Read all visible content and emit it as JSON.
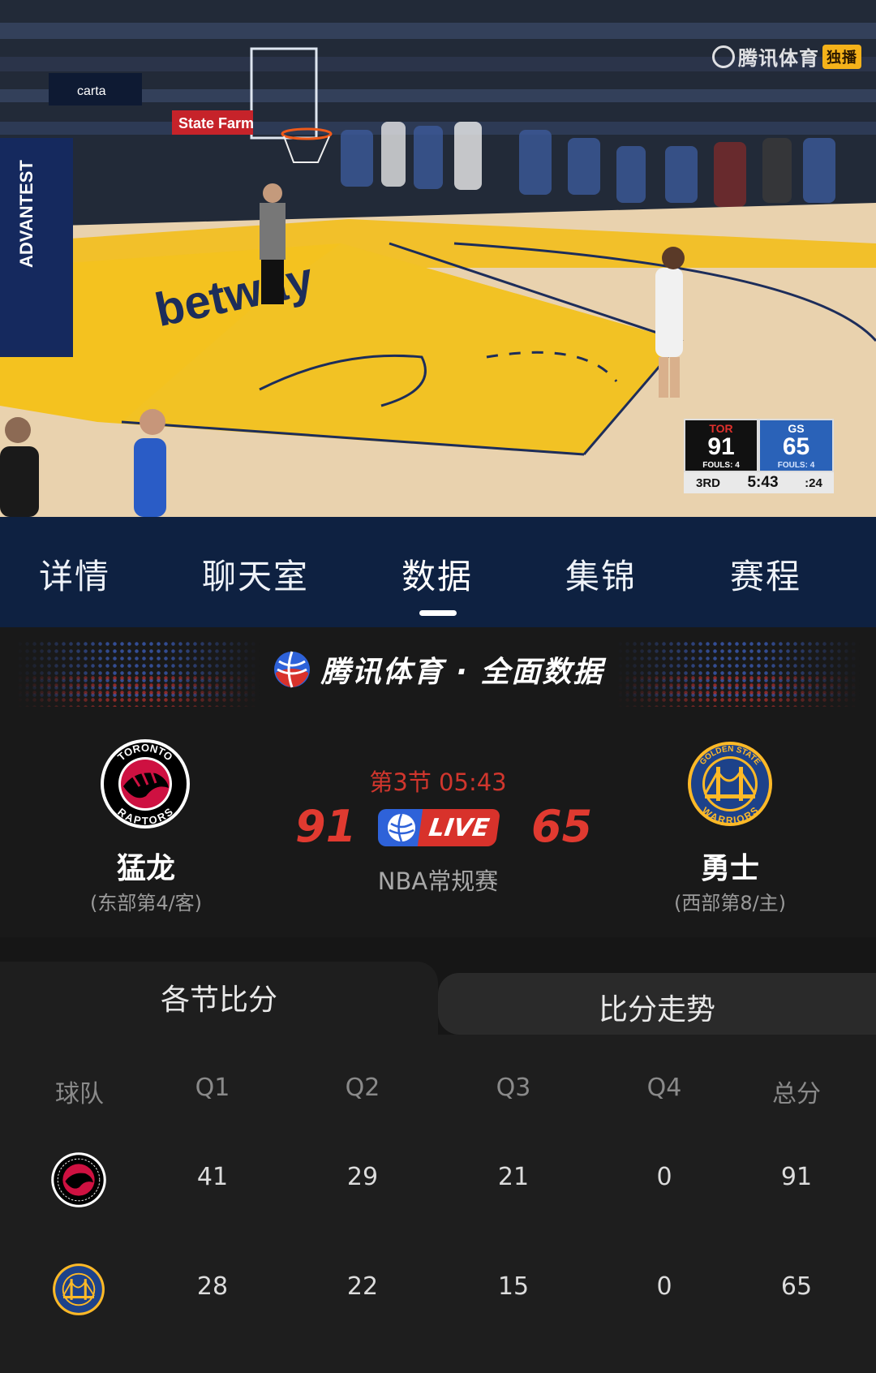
{
  "video": {
    "watermark": "腾讯体育",
    "watermark_tag": "独播",
    "arena_signs": [
      "State Farm",
      "carta",
      "ADVANTEST",
      "betway"
    ],
    "scorebug": {
      "away_abbr": "TOR",
      "home_abbr": "GS",
      "away_points": "91",
      "home_points": "65",
      "away_fouls": "FOULS: 4",
      "home_fouls": "FOULS: 4",
      "period": "3RD",
      "clock": "5:43",
      "shot_clock": ":24"
    }
  },
  "tabs": [
    {
      "label": "详情"
    },
    {
      "label": "聊天室"
    },
    {
      "label": "数据",
      "active": true
    },
    {
      "label": "集锦"
    },
    {
      "label": "赛程"
    }
  ],
  "brand": {
    "icon": "tencent-sports-ball-icon",
    "text": "腾讯体育 · 全面数据"
  },
  "match": {
    "away": {
      "name": "猛龙",
      "rank": "(东部第4/客)",
      "logo": "raptors-logo-icon",
      "logo_ring_text": "TORONTO RAPTORS",
      "score": "91"
    },
    "home": {
      "name": "勇士",
      "rank": "(西部第8/主)",
      "logo": "warriors-logo-icon",
      "logo_ring_text": "GOLDEN STATE WARRIORS",
      "score": "65"
    },
    "period_time": "第3节 05:43",
    "live_label": "LIVE",
    "competition": "NBA常规赛"
  },
  "subtabs": {
    "active": "各节比分",
    "inactive": "比分走势"
  },
  "score_table": {
    "headers": [
      "球队",
      "Q1",
      "Q2",
      "Q3",
      "Q4",
      "总分"
    ],
    "rows": [
      {
        "team_logo": "raptors-logo-icon",
        "q1": "41",
        "q2": "29",
        "q3": "21",
        "q4": "0",
        "total": "91"
      },
      {
        "team_logo": "warriors-logo-icon",
        "q1": "28",
        "q2": "22",
        "q3": "15",
        "q4": "0",
        "total": "65"
      }
    ]
  },
  "colors": {
    "accent_red": "#e03a30",
    "nav_blue": "#0e2141",
    "live_blue": "#2e62d9"
  }
}
